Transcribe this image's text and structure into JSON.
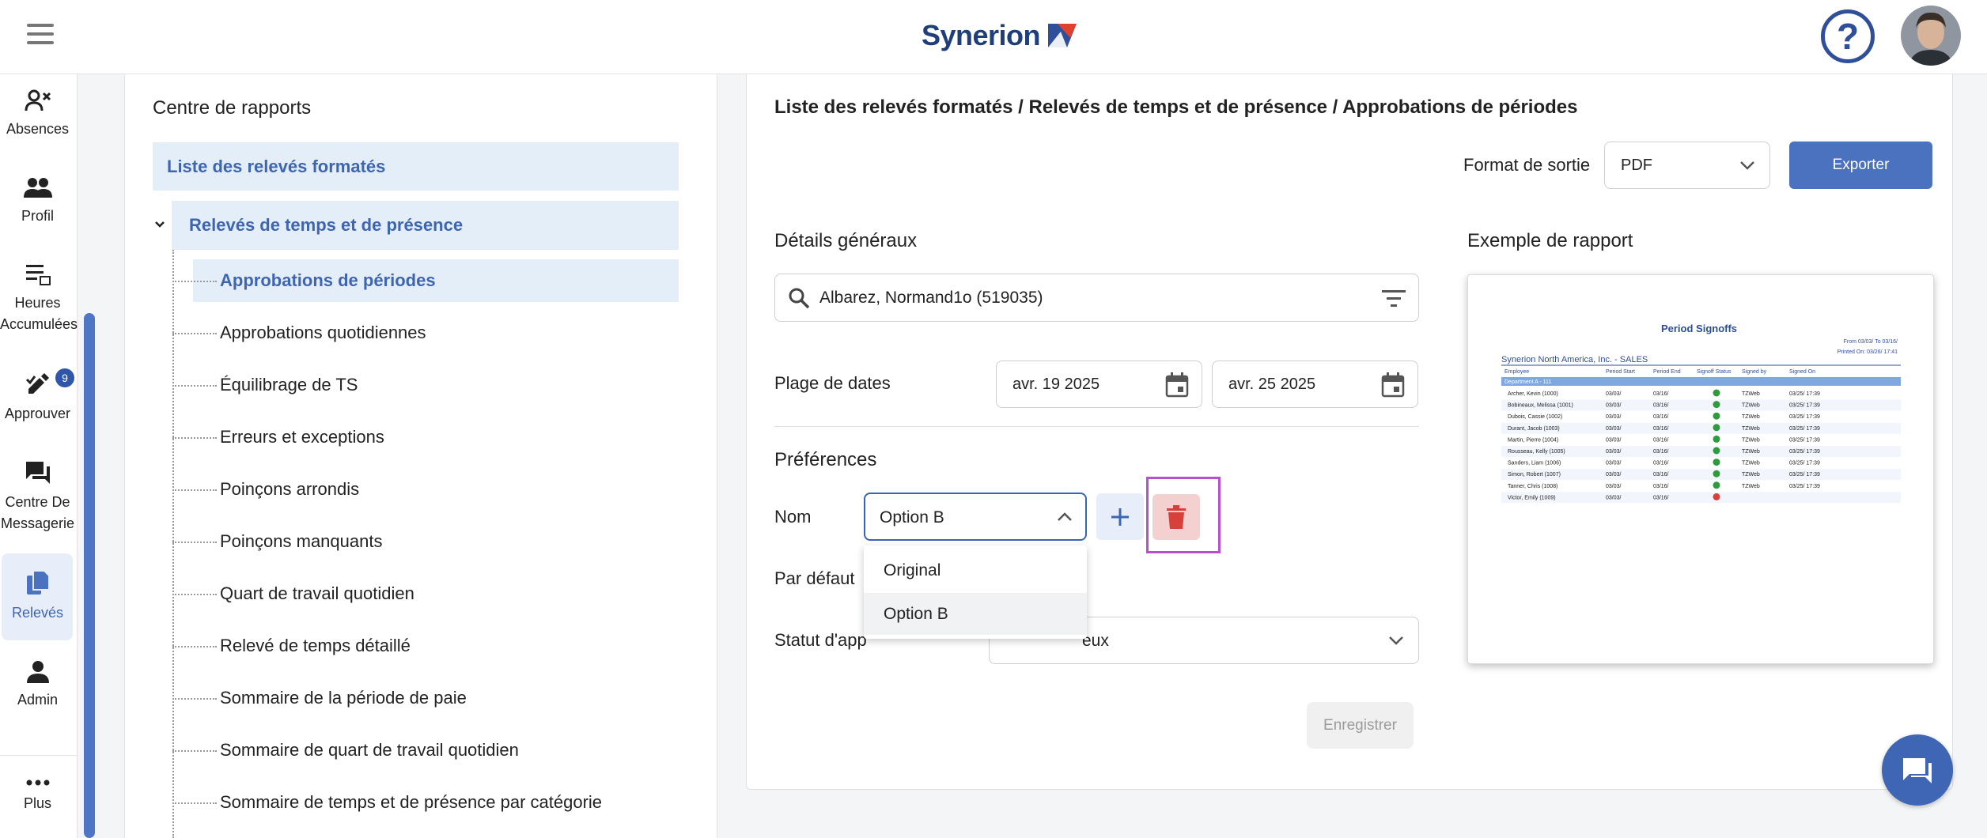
{
  "header": {
    "logo_text": "Synerion",
    "help_glyph": "?",
    "brand_color": "#1f3f7a",
    "accent_color": "#4a72bf"
  },
  "leftnav": {
    "items": [
      {
        "label": "Absences",
        "icon": "person-remove-icon"
      },
      {
        "label": "Profil",
        "icon": "people-icon"
      },
      {
        "label": "Heures Accumulées",
        "icon": "list-icon"
      },
      {
        "label": "Approuver",
        "icon": "approve-icon"
      },
      {
        "label": "Centre De Messagerie",
        "icon": "forum-icon",
        "badge": "9"
      },
      {
        "label": "Relevés",
        "icon": "file-copy-icon"
      },
      {
        "label": "Admin",
        "icon": "person-icon"
      },
      {
        "label": "Plus",
        "icon": "more-icon"
      }
    ]
  },
  "tree": {
    "title": "Centre de rapports",
    "formatted_list": "Liste des relevés formatés",
    "group": "Relevés de temps et de présence",
    "items": [
      "Approbations de périodes",
      "Approbations quotidiennes",
      "Équilibrage de TS",
      "Erreurs et exceptions",
      "Poinçons arrondis",
      "Poinçons manquants",
      "Quart de travail quotidien",
      "Relevé de temps détaillé",
      "Sommaire de la période de paie",
      "Sommaire de quart de travail quotidien",
      "Sommaire de temps et de présence par catégorie"
    ],
    "selected_index": 0
  },
  "main": {
    "breadcrumb": "Liste des relevés formatés / Relevés de temps et de présence / Approbations de périodes",
    "output_format_label": "Format de sortie",
    "output_format_value": "PDF",
    "export_label": "Exporter",
    "general_title": "Détails généraux",
    "search_value": "Albarez, Normand1o (519035)",
    "date_range_label": "Plage de dates",
    "date_from": "avr. 19 2025",
    "date_to": "avr. 25 2025",
    "preferences_title": "Préférences",
    "name_label": "Nom",
    "name_value": "Option B",
    "default_label": "Par défaut",
    "status_label": "Statut d'app",
    "status_value": "eux",
    "save_label": "Enregistrer",
    "dropdown_options": [
      "Original",
      "Option B"
    ],
    "example_title": "Exemple de rapport"
  },
  "preview": {
    "title": "Period Signoffs",
    "from_line": "From 03/03/ To 03/16/",
    "printed_line": "Printed On: 03/26/ 17:41",
    "company": "Synerion North America, Inc. - SALES",
    "columns": [
      "Employee",
      "Period Start",
      "Period End",
      "Signoff Status",
      "Signed by",
      "Signed On"
    ],
    "department": "Department A - 111",
    "rows": [
      {
        "name": "Archer, Kevin (1000)",
        "start": "03/03/",
        "end": "03/16/",
        "ok": true,
        "by": "TZWeb",
        "on": "03/25/ 17:39"
      },
      {
        "name": "Bobineaux, Melissa (1001)",
        "start": "03/03/",
        "end": "03/16/",
        "ok": true,
        "by": "TZWeb",
        "on": "03/25/ 17:39"
      },
      {
        "name": "Dubois, Cassie (1002)",
        "start": "03/03/",
        "end": "03/16/",
        "ok": true,
        "by": "TZWeb",
        "on": "03/25/ 17:39"
      },
      {
        "name": "Durant, Jacob (1003)",
        "start": "03/03/",
        "end": "03/16/",
        "ok": true,
        "by": "TZWeb",
        "on": "03/25/ 17:39"
      },
      {
        "name": "Martin, Pierre (1004)",
        "start": "03/03/",
        "end": "03/16/",
        "ok": true,
        "by": "TZWeb",
        "on": "03/25/ 17:39"
      },
      {
        "name": "Rousseau, Kelly (1005)",
        "start": "03/03/",
        "end": "03/16/",
        "ok": true,
        "by": "TZWeb",
        "on": "03/25/ 17:39"
      },
      {
        "name": "Sanders, Liam (1006)",
        "start": "03/03/",
        "end": "03/16/",
        "ok": true,
        "by": "TZWeb",
        "on": "03/25/ 17:39"
      },
      {
        "name": "Simon, Robert (1007)",
        "start": "03/03/",
        "end": "03/16/",
        "ok": true,
        "by": "TZWeb",
        "on": "03/25/ 17:39"
      },
      {
        "name": "Tanner, Chris (1008)",
        "start": "03/03/",
        "end": "03/16/",
        "ok": true,
        "by": "TZWeb",
        "on": "03/25/ 17:39"
      },
      {
        "name": "Victor, Emily (1009)",
        "start": "03/03/",
        "end": "03/16/",
        "ok": false,
        "by": "",
        "on": ""
      }
    ]
  }
}
